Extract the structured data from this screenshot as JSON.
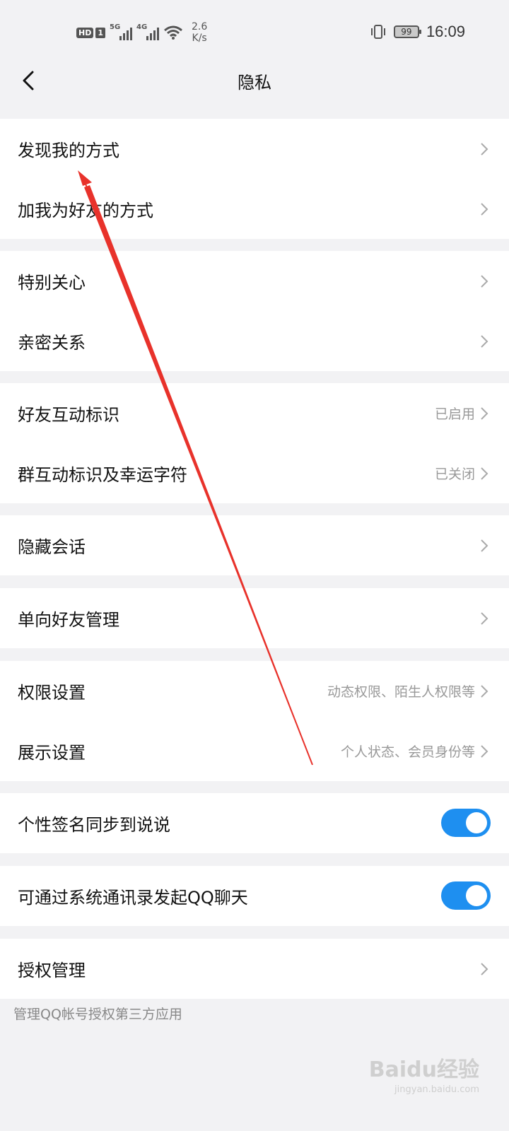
{
  "status_bar": {
    "hd": "HD",
    "sim": "1",
    "net1": "5G",
    "net2": "4G",
    "speed_value": "2.6",
    "speed_unit": "K/s",
    "battery": "99",
    "time": "16:09"
  },
  "nav": {
    "title": "隐私",
    "back_icon": "chevron-left-icon"
  },
  "groups": [
    {
      "rows": [
        {
          "label": "发现我的方式"
        },
        {
          "label": "加我为好友的方式"
        }
      ]
    },
    {
      "rows": [
        {
          "label": "特别关心"
        },
        {
          "label": "亲密关系"
        }
      ]
    },
    {
      "rows": [
        {
          "label": "好友互动标识",
          "value": "已启用"
        },
        {
          "label": "群互动标识及幸运字符",
          "value": "已关闭"
        }
      ]
    },
    {
      "rows": [
        {
          "label": "隐藏会话"
        }
      ]
    },
    {
      "rows": [
        {
          "label": "单向好友管理"
        }
      ]
    },
    {
      "rows": [
        {
          "label": "权限设置",
          "value": "动态权限、陌生人权限等"
        },
        {
          "label": "展示设置",
          "value": "个人状态、会员身份等"
        }
      ]
    },
    {
      "rows": [
        {
          "label": "个性签名同步到说说",
          "toggle": true
        }
      ]
    },
    {
      "rows": [
        {
          "label": "可通过系统通讯录发起QQ聊天",
          "toggle": true
        }
      ]
    },
    {
      "rows": [
        {
          "label": "授权管理"
        }
      ]
    }
  ],
  "footnote": "管理QQ帐号授权第三方应用",
  "watermark": {
    "brand": "Baidu经验",
    "domain": "jingyan.baidu.com"
  },
  "colors": {
    "accent": "#1e8ff0",
    "annotation_arrow": "#e8322b",
    "background": "#f2f2f4"
  }
}
